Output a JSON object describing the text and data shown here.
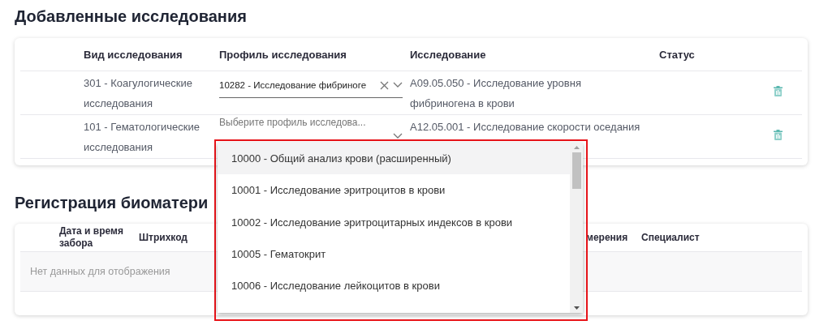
{
  "studies": {
    "title": "Добавленные исследования",
    "columns": [
      "Вид исследования",
      "Профиль исследования",
      "Исследование",
      "Статус"
    ],
    "rows": [
      {
        "type": "301 - Коагулогические исследования",
        "profile": {
          "value": "10282 - Исследование фибриноге"
        },
        "study": "А09.05.050 - Исследование уровня фибриногена в крови"
      },
      {
        "type": "101 - Гематологические исследования",
        "profile": {
          "placeholder": "Выберите профиль исследова..."
        },
        "study": "А12.05.001 - Исследование скорости оседания"
      }
    ]
  },
  "biomaterial": {
    "title": "Регистрация биоматери",
    "columns": [
      "Дата и время забора",
      "Штрихкод",
      "мерения",
      "Специалист"
    ],
    "empty_text": "Нет данных для отображения"
  },
  "dropdown": {
    "options": [
      {
        "label": "10000 - Общий анализ крови (расширенный)",
        "selected": true
      },
      {
        "label": "10001 - Исследование эритроцитов в крови",
        "selected": false
      },
      {
        "label": "10002 - Исследование эритроцитарных индексов в крови",
        "selected": false
      },
      {
        "label": "10005 - Гематокрит",
        "selected": false
      },
      {
        "label": "10006 - Исследование лейкоцитов в крови",
        "selected": false
      }
    ]
  }
}
